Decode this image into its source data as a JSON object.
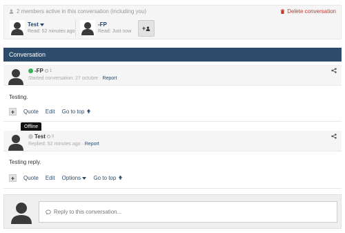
{
  "members": {
    "summary": "2 members active in this conversation (including you)",
    "delete_label": "Delete conversation",
    "list": [
      {
        "name": "Test",
        "read": "Read: 52 minutes ago",
        "dropdown": true
      },
      {
        "name": "-FP",
        "read": "Read: Just now"
      }
    ],
    "add_label": "+",
    "colors": {
      "link": "#1f3f66",
      "delete": "#c0392b"
    }
  },
  "conversation": {
    "title": "Conversation",
    "header_color": "#2d4c6b"
  },
  "messages": [
    {
      "author": "-FP",
      "status": "online",
      "rep": "1",
      "meta_prefix": "Started conversation:",
      "date": "27 octubre",
      "report": "Report",
      "body": "Testing.",
      "actions": [
        "Quote",
        "Edit",
        "Go to top"
      ]
    },
    {
      "author": "Test",
      "status": "offline",
      "rep": "0",
      "meta_prefix": "Replied:",
      "date": "52 minutes ago",
      "report": "Report",
      "body": "Testing reply.",
      "actions": [
        "Quote",
        "Edit",
        "Options",
        "Go to top"
      ]
    }
  ],
  "tooltip": "Offline",
  "reply": {
    "placeholder": "Reply to this conversation..."
  },
  "icons": [
    "user-icon",
    "trash-icon",
    "chevron-down-icon",
    "add-user-icon",
    "share-icon",
    "arrow-up-icon",
    "comment-icon"
  ]
}
